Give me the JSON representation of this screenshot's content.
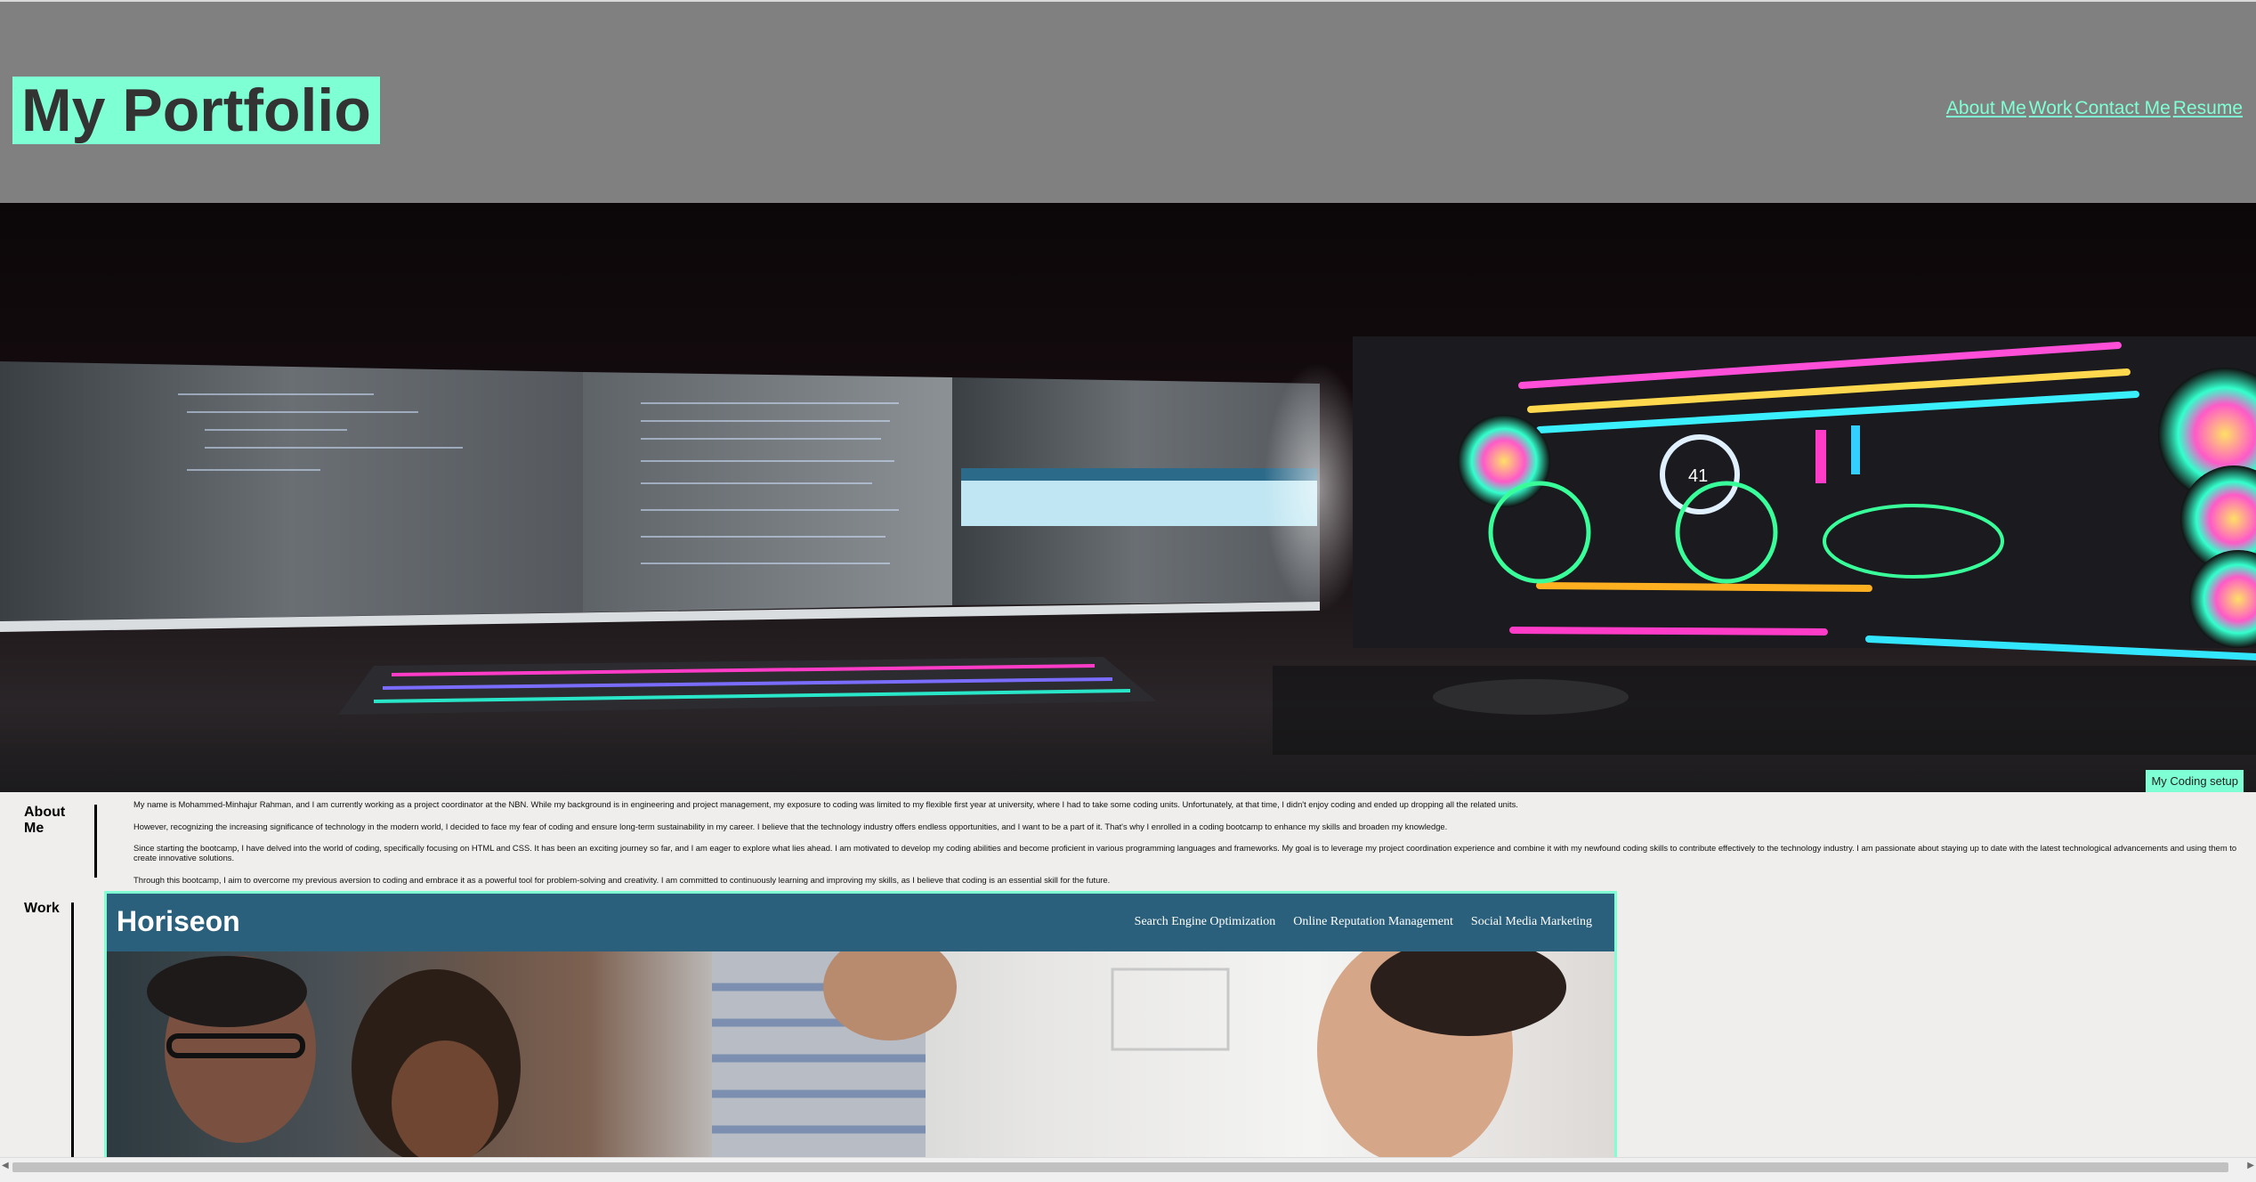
{
  "header": {
    "title": "My Portfolio",
    "nav": [
      "About Me",
      "Work",
      "Contact Me",
      "Resume"
    ]
  },
  "hero": {
    "caption": "My Coding setup"
  },
  "about": {
    "heading": "About Me",
    "paragraphs": [
      "My name is Mohammed-Minhajur Rahman, and I am currently working as a project coordinator at the NBN. While my background is in engineering and project management, my exposure to coding was limited to my flexible first year at university, where I had to take some coding units. Unfortunately, at that time, I didn't enjoy coding and ended up dropping all the related units.",
      "However, recognizing the increasing significance of technology in the modern world, I decided to face my fear of coding and ensure long-term sustainability in my career. I believe that the technology industry offers endless opportunities, and I want to be a part of it. That's why I enrolled in a coding bootcamp to enhance my skills and broaden my knowledge.",
      "Since starting the bootcamp, I have delved into the world of coding, specifically focusing on HTML and CSS. It has been an exciting journey so far, and I am eager to explore what lies ahead. I am motivated to develop my coding abilities and become proficient in various programming languages and frameworks. My goal is to leverage my project coordination experience and combine it with my newfound coding skills to contribute effectively to the technology industry. I am passionate about staying up to date with the latest technological advancements and using them to create innovative solutions.",
      "Through this bootcamp, I aim to overcome my previous aversion to coding and embrace it as a powerful tool for problem-solving and creativity. I am committed to continuously learning and improving my skills, as I believe that coding is an essential skill for the future."
    ]
  },
  "work": {
    "heading": "Work",
    "project": {
      "logo": "Horiseon",
      "nav": [
        "Search Engine Optimization",
        "Online Reputation Management",
        "Social Media Marketing"
      ]
    }
  },
  "colors": {
    "header_bg": "#808080",
    "accent": "#7fffd4",
    "page_bg": "#efeeec",
    "project_bar": "#2a607c"
  }
}
